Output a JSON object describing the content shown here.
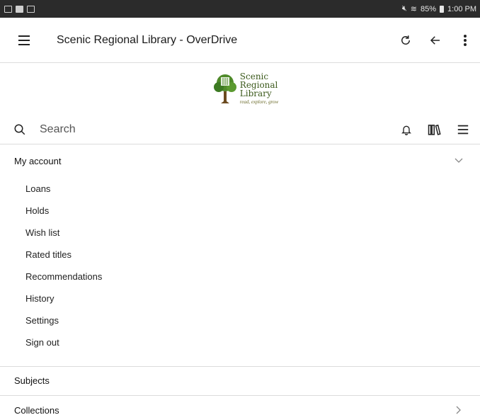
{
  "status_bar": {
    "battery": "85%",
    "time": "1:00 PM"
  },
  "app_bar": {
    "title": "Scenic Regional Library - OverDrive"
  },
  "logo": {
    "line1": "Scenic",
    "line2": "Regional",
    "line3": "Library",
    "tagline": "read, explore, grow"
  },
  "search": {
    "placeholder": "Search"
  },
  "account": {
    "heading": "My account",
    "items": [
      "Loans",
      "Holds",
      "Wish list",
      "Rated titles",
      "Recommendations",
      "History",
      "Settings",
      "Sign out"
    ]
  },
  "subjects": {
    "heading": "Subjects"
  },
  "collections": {
    "heading": "Collections"
  },
  "colors": {
    "status_bar_bg": "#2b2b2b",
    "logo_green": "#3c5a1c",
    "divider": "#dcdcdc"
  }
}
